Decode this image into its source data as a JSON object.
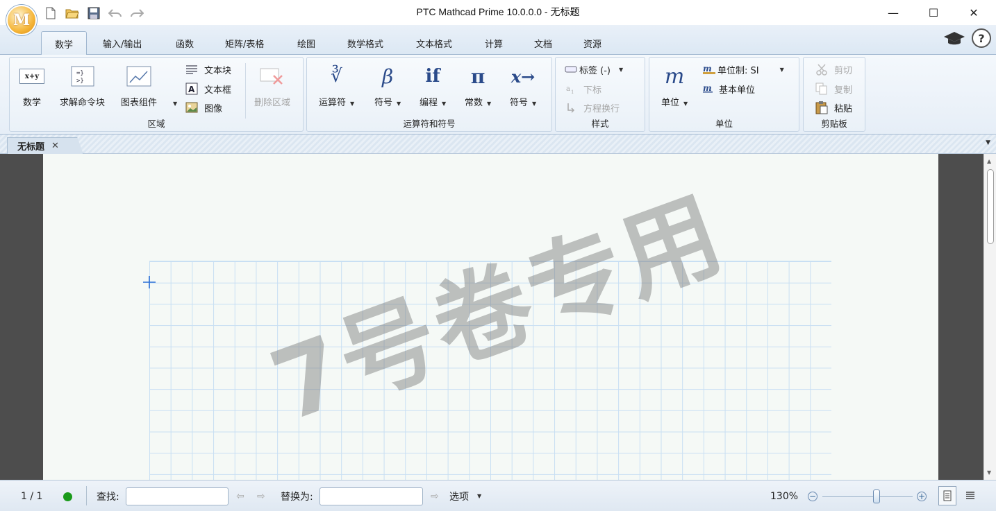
{
  "app": {
    "logo_letter": "M",
    "title": "PTC Mathcad Prime 10.0.0.0 - 无标题"
  },
  "quick_access": [
    "new-document-icon",
    "open-folder-icon",
    "save-icon",
    "undo-icon",
    "redo-icon"
  ],
  "window_controls": {
    "minimize": "—",
    "maximize": "☐",
    "close": "✕"
  },
  "tabs": [
    {
      "label": "数学"
    },
    {
      "label": "输入/输出"
    },
    {
      "label": "函数"
    },
    {
      "label": "矩阵/表格"
    },
    {
      "label": "绘图"
    },
    {
      "label": "数学格式"
    },
    {
      "label": "文本格式"
    },
    {
      "label": "计算"
    },
    {
      "label": "文档"
    },
    {
      "label": "资源"
    }
  ],
  "help": {
    "question": "?"
  },
  "ribbon": {
    "regions": {
      "label": "区域",
      "math": "数学",
      "math_icon_text": "x+y",
      "solve_block": "求解命令块",
      "chart": "图表组件",
      "text_block": "文本块",
      "text_box": "文本框",
      "image": "图像",
      "delete_region": "删除区域"
    },
    "operators": {
      "label": "运算符和符号",
      "operators": "运算符",
      "operators_glyph": "∛",
      "symbols": "符号",
      "symbols_glyph": "β",
      "programming": "编程",
      "programming_glyph": "if",
      "constants": "常数",
      "constants_glyph": "π",
      "symbolics": "符号",
      "symbolics_glyph": "x→"
    },
    "style": {
      "label": "样式",
      "tag": "标签 (-)",
      "subscript": "下标",
      "line_break": "方程换行"
    },
    "units": {
      "label": "单位",
      "units": "单位",
      "units_glyph": "m",
      "unit_system": "单位制: SI",
      "base_units": "基本单位"
    },
    "clipboard": {
      "label": "剪贴板",
      "cut": "剪切",
      "copy": "复制",
      "paste": "粘贴"
    }
  },
  "document_tab": {
    "label": "无标题",
    "close": "✕"
  },
  "worksheet": {
    "watermark": "7号卷专用"
  },
  "status": {
    "page": "1 / 1",
    "find_label": "查找:",
    "find_value": "",
    "replace_label": "替换为:",
    "replace_value": "",
    "options": "选项",
    "zoom": "130%",
    "zoom_level": 0.6,
    "status_color": "#1a9a1a"
  }
}
